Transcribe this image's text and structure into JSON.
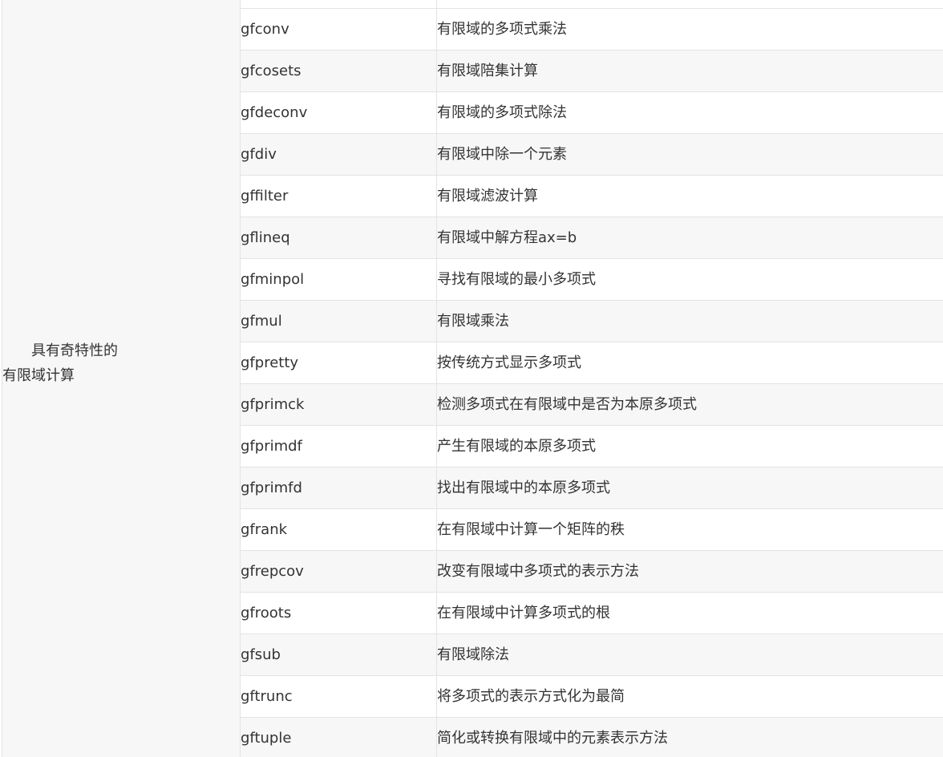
{
  "table": {
    "category": {
      "line1": "具有奇特性的",
      "line2": "有限域计算"
    },
    "rows": [
      {
        "func": "",
        "desc": ""
      },
      {
        "func": "gfconv",
        "desc": "有限域的多项式乘法"
      },
      {
        "func": "gfcosets",
        "desc": "有限域陪集计算"
      },
      {
        "func": "gfdeconv",
        "desc": "有限域的多项式除法"
      },
      {
        "func": "gfdiv",
        "desc": "有限域中除一个元素"
      },
      {
        "func": "gffilter",
        "desc": "有限域滤波计算"
      },
      {
        "func": "gflineq",
        "desc": "有限域中解方程ax=b"
      },
      {
        "func": "gfminpol",
        "desc": "寻找有限域的最小多项式"
      },
      {
        "func": "gfmul",
        "desc": "有限域乘法"
      },
      {
        "func": "gfpretty",
        "desc": "按传统方式显示多项式"
      },
      {
        "func": "gfprimck",
        "desc": "检测多项式在有限域中是否为本原多项式"
      },
      {
        "func": "gfprimdf",
        "desc": "产生有限域的本原多项式"
      },
      {
        "func": "gfprimfd",
        "desc": "找出有限域中的本原多项式"
      },
      {
        "func": "gfrank",
        "desc": "在有限域中计算一个矩阵的秩"
      },
      {
        "func": "gfrepcov",
        "desc": "改变有限域中多项式的表示方法"
      },
      {
        "func": "gfroots",
        "desc": "在有限域中计算多项式的根"
      },
      {
        "func": "gfsub",
        "desc": "有限域除法"
      },
      {
        "func": "gftrunc",
        "desc": "将多项式的表示方式化为最简"
      },
      {
        "func": "gftuple",
        "desc": "简化或转换有限域中的元素表示方法"
      }
    ]
  }
}
